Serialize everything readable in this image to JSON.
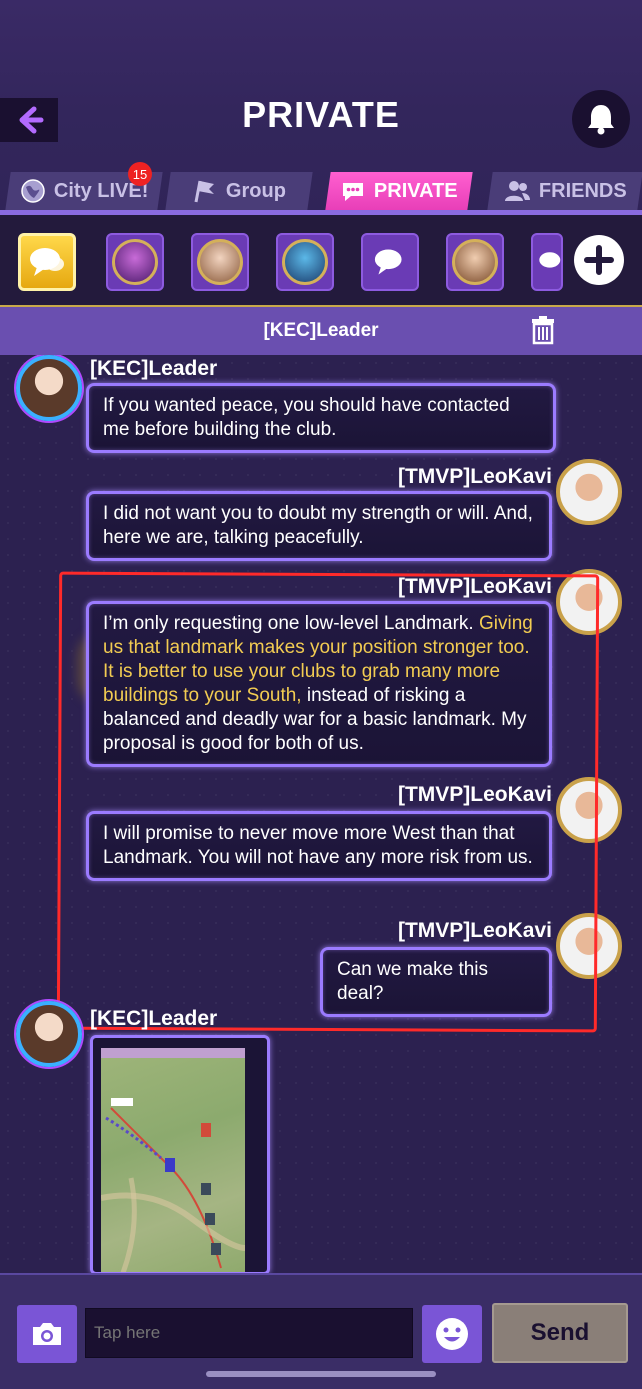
{
  "header": {
    "title": "PRIVATE"
  },
  "tabs": [
    {
      "label": "City LIVE!",
      "badge": "15"
    },
    {
      "label": "Group"
    },
    {
      "label": "PRIVATE",
      "active": true
    },
    {
      "label": "FRIENDS"
    }
  ],
  "conversation": {
    "title": "[KEC]Leader"
  },
  "messages": [
    {
      "sender": "[KEC]Leader",
      "side": "left",
      "text": "If you wanted peace, you should have contacted me before building the club."
    },
    {
      "sender": "[TMVP]LeoKavi",
      "side": "right",
      "text": "I did not want you to doubt my strength or will. And, here we are, talking peacefully."
    },
    {
      "sender": "[TMVP]LeoKavi",
      "side": "right",
      "text_part1": "I’m only requesting one low-level Landmark.",
      "text_part2": "Giving us that landmark makes your position stronger too. It is better to use your clubs to grab many more buildings to your South,",
      "text_part3": "instead of risking a balanced and deadly war for a basic landmark. My proposal is good for both of us."
    },
    {
      "sender": "[TMVP]LeoKavi",
      "side": "right",
      "text": "I will promise to never move more West than that Landmark. You will not have any more risk from us."
    },
    {
      "sender": "[TMVP]LeoKavi",
      "side": "right",
      "text": "Can we make this deal?"
    },
    {
      "sender": "[KEC]Leader",
      "side": "left",
      "type": "image"
    }
  ],
  "input": {
    "placeholder": "Tap here",
    "send_label": "Send"
  },
  "colors": {
    "accent": "#e83fb8",
    "bubble_border": "#9b7bff",
    "annotation": "#ff2a2a",
    "highlight_text": "#f2cc52"
  }
}
